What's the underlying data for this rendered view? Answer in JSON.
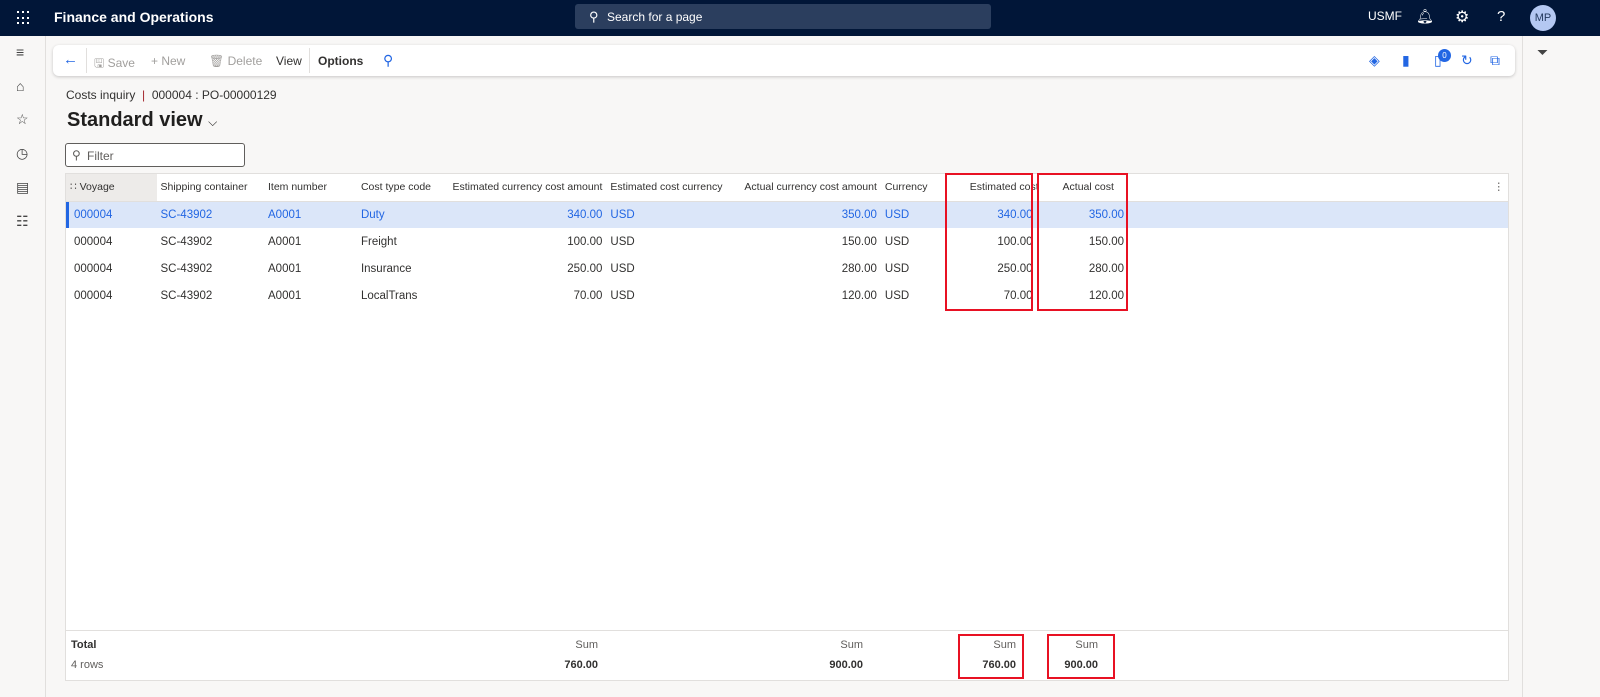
{
  "app": {
    "title": "Finance and Operations",
    "search_placeholder": "Search for a page",
    "company": "USMF",
    "avatar": "MP"
  },
  "toolbar": {
    "save": "Save",
    "new": "New",
    "delete": "Delete",
    "view": "View",
    "options": "Options",
    "badge_count": "0"
  },
  "breadcrumb": {
    "page": "Costs inquiry",
    "separator": "|",
    "record": "000004 : PO-00000129"
  },
  "view": {
    "title": "Standard view"
  },
  "filter": {
    "placeholder": "Filter"
  },
  "grid": {
    "columns": [
      "Voyage",
      "Shipping container",
      "Item number",
      "Cost type code",
      "Estimated currency cost amount",
      "Estimated cost currency",
      "Actual currency cost amount",
      "Currency",
      "Estimated cost",
      "Actual cost"
    ],
    "rows": [
      [
        "000004",
        "SC-43902",
        "A0001",
        "Duty",
        "340.00",
        "USD",
        "350.00",
        "USD",
        "340.00",
        "350.00"
      ],
      [
        "000004",
        "SC-43902",
        "A0001",
        "Freight",
        "100.00",
        "USD",
        "150.00",
        "USD",
        "100.00",
        "150.00"
      ],
      [
        "000004",
        "SC-43902",
        "A0001",
        "Insurance",
        "250.00",
        "USD",
        "280.00",
        "USD",
        "250.00",
        "280.00"
      ],
      [
        "000004",
        "SC-43902",
        "A0001",
        "LocalTrans",
        "70.00",
        "USD",
        "120.00",
        "USD",
        "70.00",
        "120.00"
      ]
    ]
  },
  "footer": {
    "total_label": "Total",
    "rows_label": "4 rows",
    "sum_label": "Sum",
    "sums": [
      "760.00",
      "900.00",
      "760.00",
      "900.00"
    ]
  }
}
